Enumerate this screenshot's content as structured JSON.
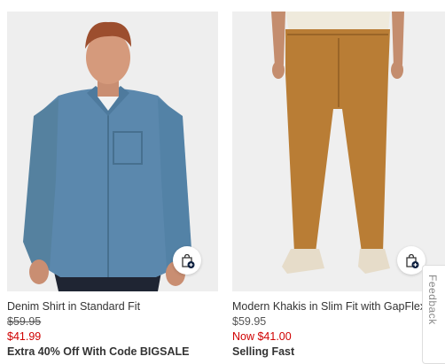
{
  "products": [
    {
      "name": "Denim Shirt in Standard Fit",
      "original_price": "$59.95",
      "sale_price": "$41.99",
      "promo": "Extra 40% Off With Code BIGSALE",
      "image": "denim-shirt-photo"
    },
    {
      "name": "Modern Khakis in Slim Fit with GapFlex",
      "original_price": "$59.95",
      "sale_price": "Now $41.00",
      "promo": "Selling Fast",
      "image": "khakis-photo"
    }
  ],
  "feedback_label": "Feedback",
  "icons": {
    "add_to_bag": "shopping-bag-plus-icon"
  },
  "colors": {
    "sale": "#d00000",
    "badge": "#0c1f3f"
  }
}
